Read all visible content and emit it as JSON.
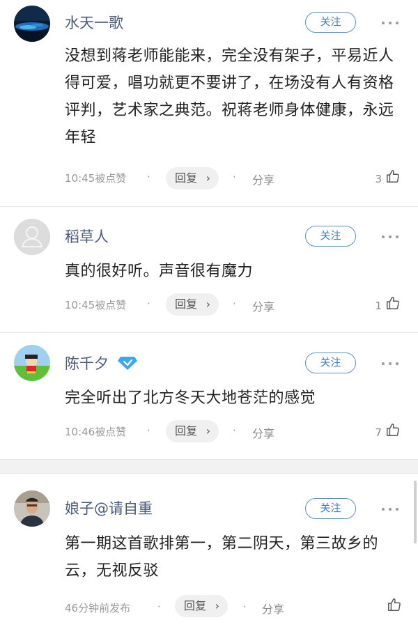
{
  "comments": [
    {
      "username": "水天一歌",
      "follow_label": "关注",
      "text": "没想到蒋老师能能来，完全没有架子，平易近人得可爱，唱功就更不要讲了，在场没有人有资格评判，艺术家之典范。祝蒋老师身体健康，永远年轻",
      "time": "10:45被点赞",
      "reply_label": "回复",
      "reply_chevron": "›",
      "share_label": "分享",
      "likes": "3"
    },
    {
      "username": "稻草人",
      "follow_label": "关注",
      "text": "真的很好听。声音很有魔力",
      "time": "10:45被点赞",
      "reply_label": "回复",
      "reply_chevron": "›",
      "share_label": "分享",
      "likes": "1"
    },
    {
      "username": "陈千夕",
      "follow_label": "关注",
      "text": "完全听出了北方冬天大地苍茫的感觉",
      "time": "10:46被点赞",
      "reply_label": "回复",
      "reply_chevron": "›",
      "share_label": "分享",
      "likes": "7",
      "badge": "diamond-vip-icon"
    },
    {
      "username": "娘子@请自重",
      "follow_label": "关注",
      "text": "第一期这首歌排第一，第二阴天，第三故乡的云，无视反驳",
      "time": "46分钟前发布",
      "reply_label": "回复",
      "reply_chevron": "›",
      "share_label": "分享",
      "likes": ""
    }
  ],
  "separator": "·",
  "colors": {
    "username": "#4a5a78",
    "follow_border": "#5b8dd3",
    "meta": "#999999",
    "reply_bg": "#f0f0f0",
    "vip_badge": "#3ba8f0"
  }
}
